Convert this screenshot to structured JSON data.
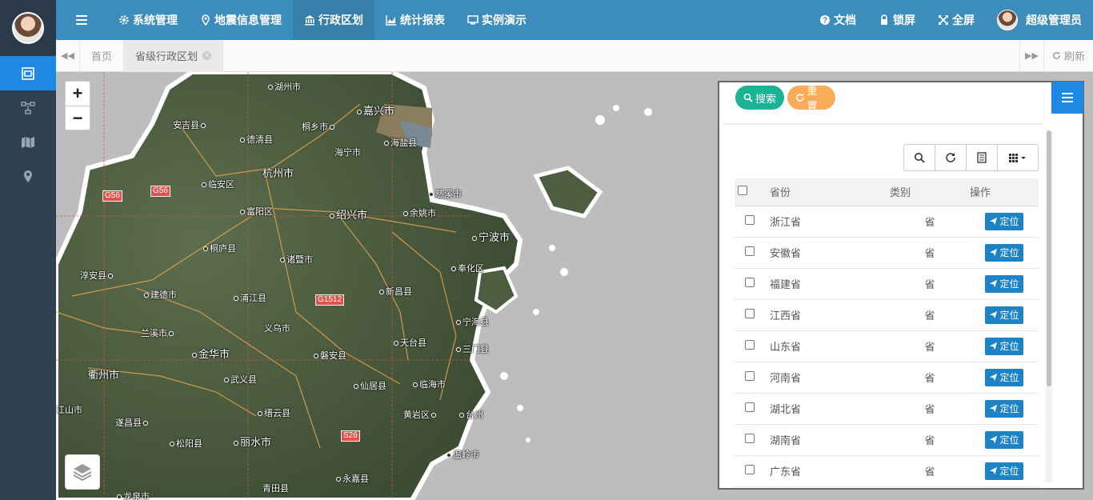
{
  "nav": {
    "items": [
      {
        "label": "系统管理",
        "icon": "gear-icon"
      },
      {
        "label": "地震信息管理",
        "icon": "map-marker-icon"
      },
      {
        "label": "行政区划",
        "icon": "bank-icon"
      },
      {
        "label": "统计报表",
        "icon": "area-chart-icon"
      },
      {
        "label": "实例演示",
        "icon": "desktop-icon"
      }
    ],
    "docs": "文档",
    "lock": "锁屏",
    "fullscreen": "全屏",
    "user": "超级管理员"
  },
  "tabs": {
    "home": "首页",
    "current": "省级行政区划",
    "refresh": "刷新"
  },
  "map": {
    "zoom_in": "+",
    "zoom_out": "−",
    "cities": [
      "湖州市",
      "嘉兴市",
      "安吉县",
      "桐乡市",
      "德清县",
      "海宁市",
      "海盐县",
      "杭州市",
      "临安区",
      "慈溪市",
      "富阳区",
      "绍兴市",
      "余姚市",
      "宁波市",
      "桐庐县",
      "诸暨市",
      "奉化区",
      "淳安县",
      "建德市",
      "浦江县",
      "新昌县",
      "义乌市",
      "宁海县",
      "兰溪市",
      "天台县",
      "三门县",
      "金华市",
      "磐安县",
      "衢州市",
      "武义县",
      "仙居县",
      "临海市",
      "江山市",
      "缙云县",
      "黄岩区",
      "台州",
      "遂昌县",
      "松阳县",
      "丽水市",
      "温岭市",
      "青田县",
      "永嘉县",
      "龙泉市"
    ],
    "roads": [
      "G56",
      "G56",
      "G1512",
      "S26"
    ]
  },
  "panel": {
    "search_btn": "搜索",
    "reset_btn": "重置",
    "columns": [
      "省份",
      "类别",
      "操作"
    ],
    "locate_label": "定位",
    "rows": [
      {
        "name": "浙江省",
        "type": "省"
      },
      {
        "name": "安徽省",
        "type": "省"
      },
      {
        "name": "福建省",
        "type": "省"
      },
      {
        "name": "江西省",
        "type": "省"
      },
      {
        "name": "山东省",
        "type": "省"
      },
      {
        "name": "河南省",
        "type": "省"
      },
      {
        "name": "湖北省",
        "type": "省"
      },
      {
        "name": "湖南省",
        "type": "省"
      },
      {
        "name": "广东省",
        "type": "省"
      }
    ]
  },
  "colors": {
    "topnav": "#3c8dbc",
    "sidebar": "#2f4050",
    "accent": "#1e88e5",
    "search": "#1ab394",
    "reset": "#f8ac59",
    "locate": "#1c84c6"
  }
}
